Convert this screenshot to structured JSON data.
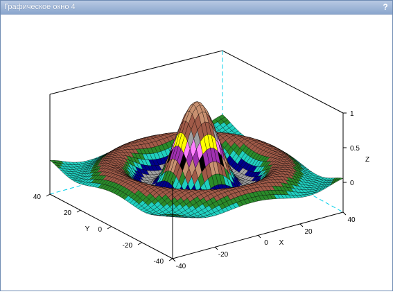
{
  "window": {
    "title": "Графическое окно 4",
    "help_label": "?"
  },
  "colors": {
    "title_text": "#ffffff",
    "axis_dashed": "#00cfe8",
    "frame": "#000000"
  },
  "chart_data": {
    "type": "surface3d",
    "function": "sin(r)/r surface on a square grid",
    "x": {
      "label": "X",
      "ticks": [
        "-40",
        "-20",
        "0",
        "20",
        "40"
      ],
      "range": [
        -40,
        40
      ]
    },
    "y": {
      "label": "Y",
      "ticks": [
        "-40",
        "-20",
        "0",
        "20",
        "40"
      ],
      "range": [
        -40,
        40
      ]
    },
    "z": {
      "label": "Z",
      "ticks": [
        "0",
        "0.5",
        "1"
      ],
      "range": [
        -0.25,
        1
      ]
    },
    "palette": [
      "#c89070",
      "#a05a48",
      "#2a8a2a",
      "#20d0c0",
      "#00008a",
      "#a0a0a0",
      "#ffff00",
      "#ff80ff",
      "#a030b0",
      "#000000"
    ]
  }
}
